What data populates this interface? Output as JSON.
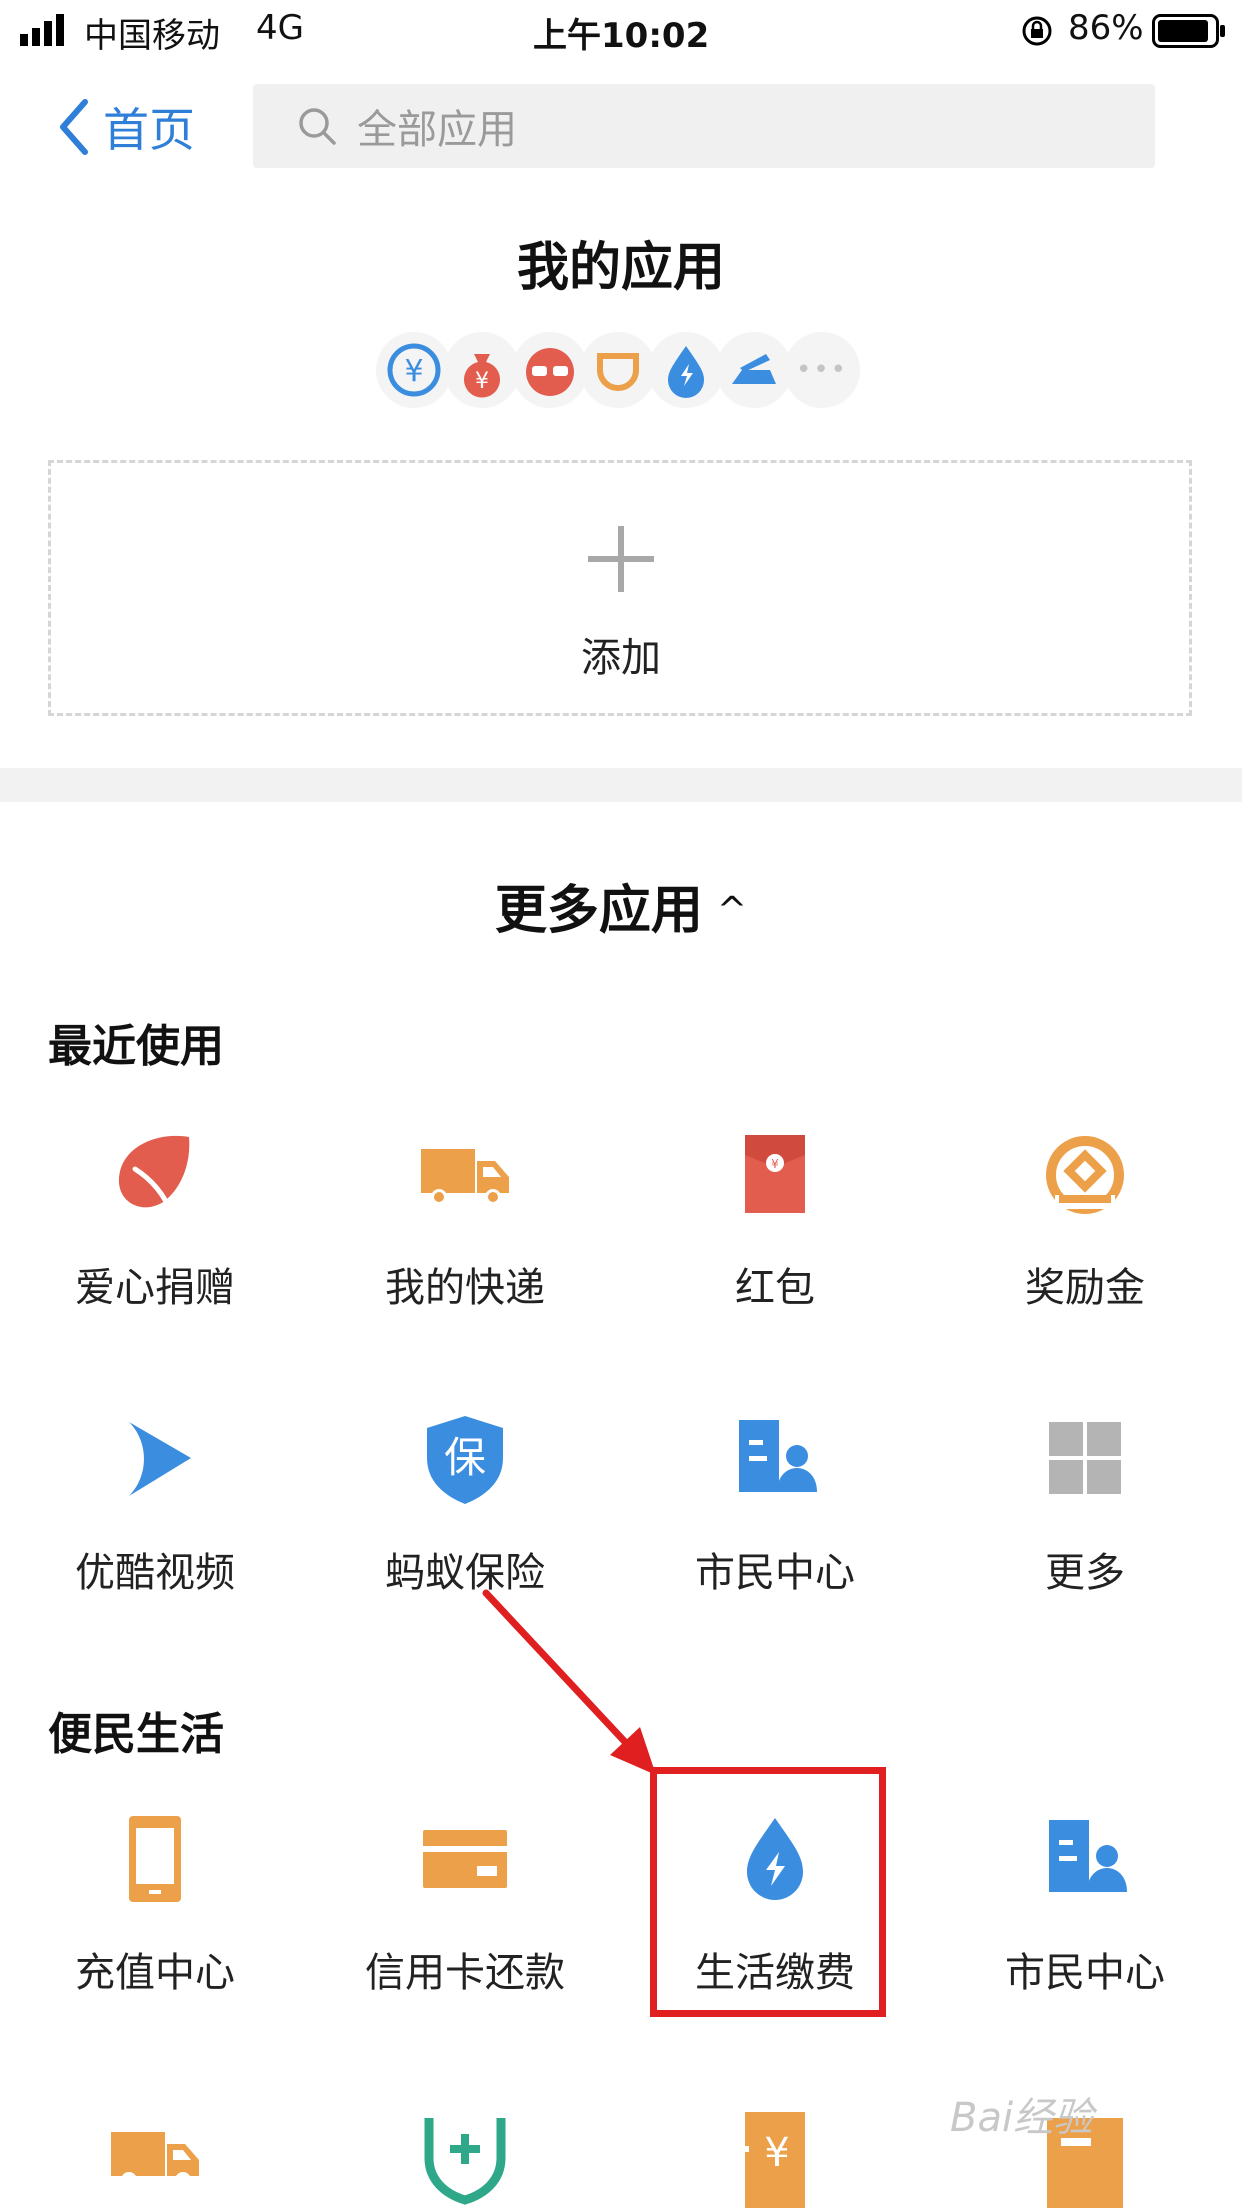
{
  "status_bar": {
    "carrier": "中国移动",
    "network": "4G",
    "time": "上午10:02",
    "battery": "86%"
  },
  "nav": {
    "back_label": "首页",
    "search_placeholder": "全部应用"
  },
  "my_apps": {
    "title": "我的应用",
    "add_label": "添加",
    "add_glyph": "+",
    "more_glyph": "•••",
    "shortcut_icons": [
      "currency-exchange-icon",
      "money-bag-icon",
      "glasses-icon",
      "cup-icon",
      "water-drop-icon",
      "transport-icon",
      "more-dots-icon"
    ]
  },
  "more_apps": {
    "title": "更多应用",
    "caret": "^"
  },
  "recent": {
    "title": "最近使用",
    "items": [
      {
        "label": "爱心捐赠",
        "icon": "heart-leaf-icon"
      },
      {
        "label": "我的快递",
        "icon": "truck-icon"
      },
      {
        "label": "红包",
        "icon": "red-envelope-icon"
      },
      {
        "label": "奖励金",
        "icon": "reward-icon"
      },
      {
        "label": "优酷视频",
        "icon": "play-icon"
      },
      {
        "label": "蚂蚁保险",
        "icon": "shield-icon",
        "glyph": "保"
      },
      {
        "label": "市民中心",
        "icon": "citizen-icon"
      },
      {
        "label": "更多",
        "icon": "grid-icon"
      }
    ]
  },
  "life": {
    "title": "便民生活",
    "items": [
      {
        "label": "充值中心",
        "icon": "phone-icon"
      },
      {
        "label": "信用卡还款",
        "icon": "credit-card-icon"
      },
      {
        "label": "生活缴费",
        "icon": "utility-drop-icon"
      },
      {
        "label": "市民中心",
        "icon": "citizen-icon"
      }
    ]
  },
  "watermark": "Bai经验",
  "colors": {
    "accent_blue": "#2f7fd9",
    "orange": "#eda04a",
    "red": "#e35d4f",
    "highlight_red": "#e02020"
  }
}
